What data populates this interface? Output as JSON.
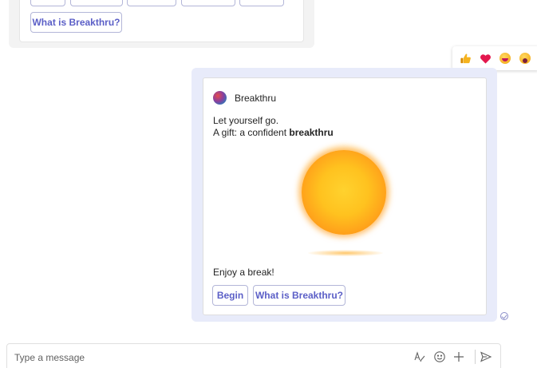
{
  "previous_card": {
    "chips_cut": [
      "",
      "",
      "",
      "",
      ""
    ],
    "chip_what_is": "What is Breakthru?"
  },
  "reactions": [
    {
      "name": "like",
      "icon": "thumbs-up-icon"
    },
    {
      "name": "heart",
      "icon": "heart-icon"
    },
    {
      "name": "laugh",
      "icon": "laugh-icon"
    },
    {
      "name": "surprised",
      "icon": "surprised-icon"
    }
  ],
  "card": {
    "app_name": "Breakthru",
    "line1": "Let yourself go.",
    "line2_prefix": "A gift: a confident ",
    "line2_bold": "breakthru",
    "footer_text": "Enjoy a break!",
    "begin_label": "Begin",
    "what_is_label": "What is Breakthru?"
  },
  "compose": {
    "placeholder": "Type a message"
  },
  "colors": {
    "accent": "#5b5fc7",
    "bubble": "#e8ebfa"
  }
}
